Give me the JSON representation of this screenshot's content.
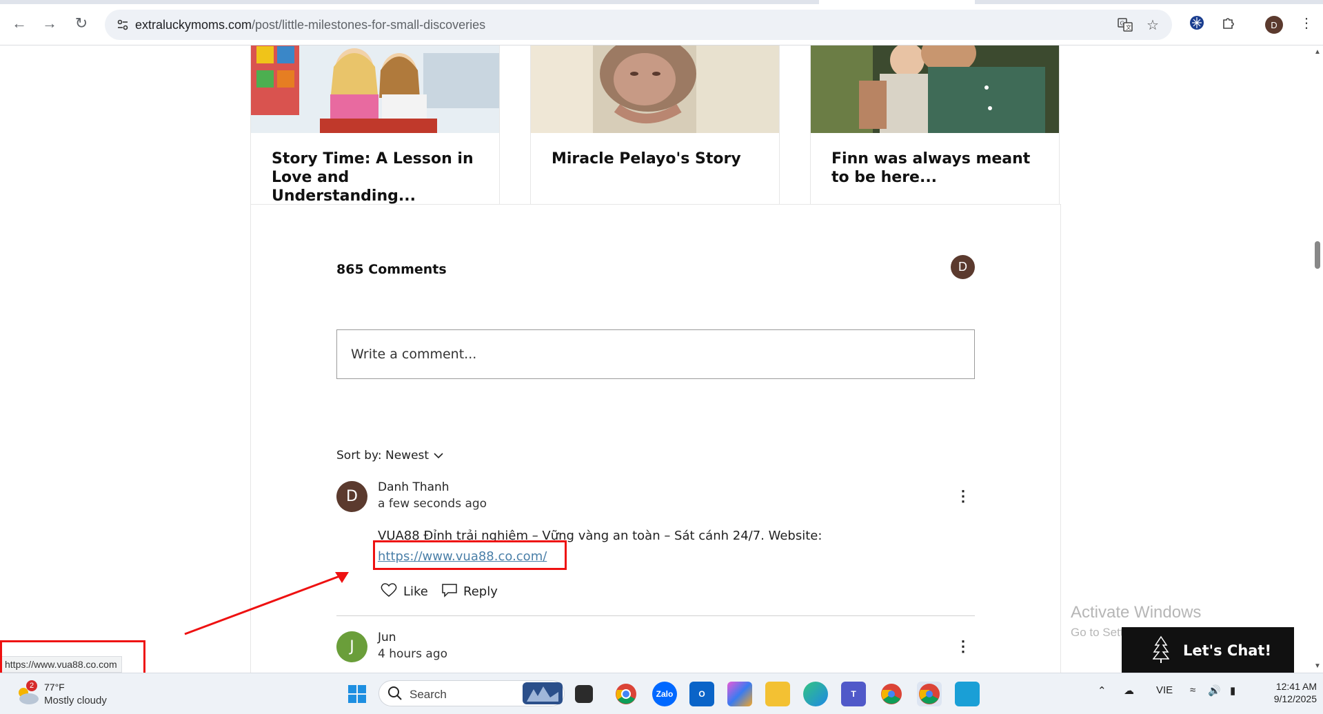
{
  "browser": {
    "url_domain": "extraluckymoms.com",
    "url_path": "/post/little-milestones-for-small-discoveries",
    "profile_initial": "D"
  },
  "related_posts": [
    {
      "title": "Story Time: A Lesson in Love and Understanding..."
    },
    {
      "title": "Miracle Pelayo's Story"
    },
    {
      "title": "Finn was always meant to be here..."
    }
  ],
  "comments": {
    "count_label": "865 Comments",
    "viewer_initial": "D",
    "input_placeholder": "Write a comment...",
    "sort_label": "Sort by: Newest",
    "items": [
      {
        "initial": "D",
        "author": "Danh Thanh",
        "time": "a few seconds ago",
        "body": "VUA88 Đỉnh trải nghiệm – Vững vàng an toàn – Sát cánh 24/7. Website:",
        "link": "https://www.vua88.co.com/",
        "like_label": "Like",
        "reply_label": "Reply",
        "avatar_color": "#5b3a2e"
      },
      {
        "initial": "J",
        "author": "Jun",
        "time": "4 hours ago",
        "avatar_color": "#6a9e3a"
      }
    ]
  },
  "status_bar_url": "https://www.vua88.co.com",
  "watermark": {
    "title": "Activate Windows",
    "subtitle": "Go to Settings to activate Windows."
  },
  "chat_widget": {
    "label": "Let's Chat!"
  },
  "taskbar": {
    "weather_badge": "2",
    "temperature": "77°F",
    "condition": "Mostly cloudy",
    "search_label": "Search",
    "language": "VIE",
    "time": "12:41 AM",
    "date": "9/12/2025"
  },
  "colors": {
    "annotation": "#e11111",
    "link": "#4a7fa8",
    "accent_avatar": "#5b3a2e"
  }
}
